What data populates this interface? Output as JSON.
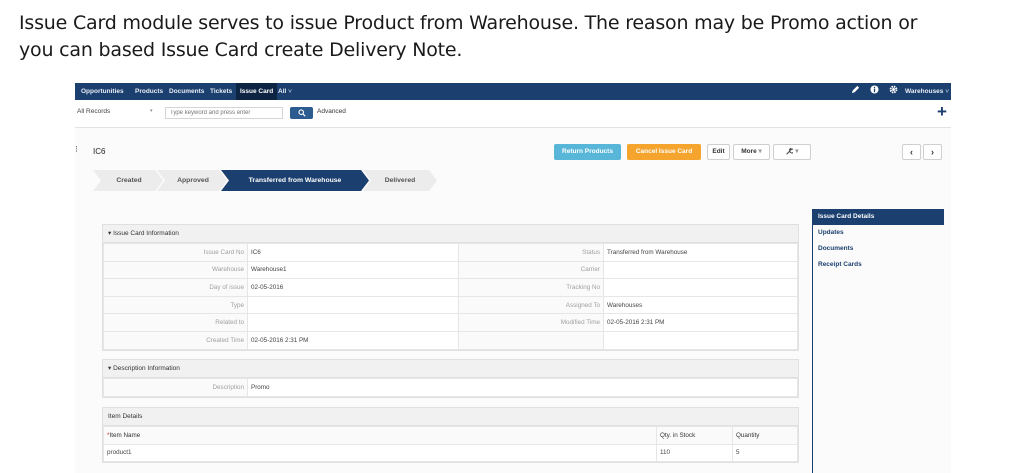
{
  "intro": {
    "line1": "Issue Card module serves to issue Product from Warehouse. The reason may be Promo action or",
    "line2": "you can based Issue Card create Delivery Note."
  },
  "nav": {
    "items": [
      "Opportunities",
      "Products",
      "Documents",
      "Tickets",
      "Issue Card",
      "All"
    ],
    "all_arrow": "˅",
    "right_label": "Warehouses",
    "icons": [
      "pencil-icon",
      "info-icon",
      "gear-icon"
    ]
  },
  "search": {
    "records_label": "All Records",
    "records_arrow": "▾",
    "placeholder": "Type keyword and press enter",
    "search_icon": "🔍",
    "advanced_label": "Advanced",
    "add_icon": "+"
  },
  "record": {
    "handle": "⁝",
    "title": "IC6",
    "buttons": {
      "return_products": "Return Products",
      "cancel_issue_card": "Cancel Issue Card",
      "edit": "Edit",
      "more": "More",
      "more_arrow": "▾",
      "wrench": "✎",
      "wrench_arrow": "▾",
      "prev": "‹",
      "next": "›"
    }
  },
  "steps": [
    "Created",
    "Approved",
    "Transferred from Warehouse",
    "Delivered"
  ],
  "info_block": {
    "header": "▾  Issue Card Information",
    "rows": [
      {
        "l1": "Issue Card No",
        "v1": "IC6",
        "l2": "Status",
        "v2": "Transferred from Warehouse"
      },
      {
        "l1": "Warehouse",
        "v1": "Warehouse1",
        "l2": "Carrier",
        "v2": ""
      },
      {
        "l1": "Day of issue",
        "v1": "02-05-2016",
        "l2": "Tracking No",
        "v2": ""
      },
      {
        "l1": "Type",
        "v1": "",
        "l2": "Assigned To",
        "v2": "Warehouses"
      },
      {
        "l1": "Related to",
        "v1": "",
        "l2": "Modified Time",
        "v2": "02-05-2016 2:31 PM"
      },
      {
        "l1": "Created Time",
        "v1": "02-05-2016 2:31 PM",
        "l2": "",
        "v2": ""
      }
    ]
  },
  "desc_block": {
    "header": "▾  Description Information",
    "label": "Description",
    "value": "Promo"
  },
  "items_block": {
    "header": "Item Details",
    "col_item": "Item Name",
    "col_item_req": "*",
    "col_stock": "Qty. in Stock",
    "col_qty": "Quantity",
    "rows": [
      {
        "name": "product1",
        "stock": "110",
        "qty": "5"
      }
    ]
  },
  "sidebar": {
    "items": [
      "Issue Card Details",
      "Updates",
      "Documents",
      "Receipt Cards"
    ]
  },
  "colors": {
    "nav_bg": "#1b3f6e",
    "step_active": "#1b3f6e",
    "step_inactive": "#ececec",
    "btn_blue": "#58b7d8",
    "btn_orange": "#f5a42d"
  }
}
